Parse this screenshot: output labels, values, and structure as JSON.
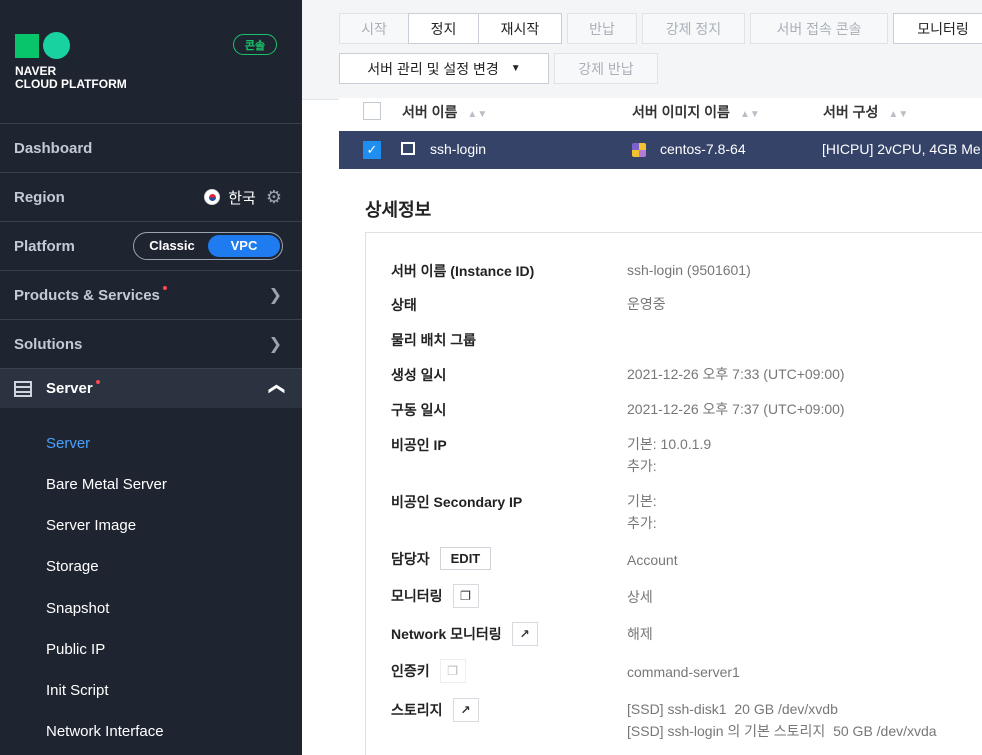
{
  "brand": {
    "line1": "NAVER",
    "line2": "CLOUD PLATFORM",
    "console_badge": "콘솔"
  },
  "sidebar": {
    "dashboard": "Dashboard",
    "region_label": "Region",
    "region_value": "한국",
    "platform_label": "Platform",
    "platform_options": [
      "Classic",
      "VPC"
    ],
    "platform_selected": "VPC",
    "products": "Products & Services",
    "solutions": "Solutions",
    "server": "Server",
    "submenu": [
      "Server",
      "Bare Metal Server",
      "Server Image",
      "Storage",
      "Snapshot",
      "Public IP",
      "Init Script",
      "Network Interface"
    ],
    "submenu_active": "Server"
  },
  "toolbar": {
    "row1": [
      "시작",
      "정지",
      "재시작",
      "반납",
      "강제 정지",
      "서버 접속 콘솔",
      "모니터링"
    ],
    "row1_enabled": [
      false,
      true,
      true,
      false,
      false,
      false,
      true
    ],
    "manage": "서버 관리 및 설정 변경",
    "force_return": "강제 반납"
  },
  "table": {
    "headers": [
      "서버 이름",
      "서버 이미지 이름",
      "서버 구성"
    ],
    "row": {
      "checked": true,
      "name": "ssh-login",
      "image": "centos-7.8-64",
      "spec": "[HICPU] 2vCPU, 4GB Me"
    }
  },
  "detail": {
    "title": "상세정보",
    "rows": [
      {
        "label": "서버 이름 (Instance ID)",
        "value": [
          "ssh-login (9501601)"
        ]
      },
      {
        "label": "상태",
        "value": [
          "운영중"
        ]
      },
      {
        "label": "물리 배치 그룹",
        "value": [
          ""
        ]
      },
      {
        "label": "생성 일시",
        "value": [
          "2021-12-26 오후 7:33 (UTC+09:00)"
        ]
      },
      {
        "label": "구동 일시",
        "value": [
          "2021-12-26 오후 7:37 (UTC+09:00)"
        ]
      },
      {
        "label": "비공인 IP",
        "value": [
          "기본: 10.0.1.9",
          "추가:"
        ]
      },
      {
        "label": "비공인 Secondary IP",
        "value": [
          "기본:",
          "추가:"
        ]
      },
      {
        "label": "담당자",
        "button": "EDIT",
        "value": [
          "Account"
        ]
      },
      {
        "label": "모니터링",
        "value": [
          "상세"
        ]
      },
      {
        "label": "Network 모니터링",
        "value": [
          "해제"
        ]
      },
      {
        "label": "인증키",
        "value": [
          "command-server1"
        ]
      },
      {
        "label": "스토리지",
        "value": [
          "[SSD] ssh-disk1  20 GB /dev/xvdb",
          "[SSD] ssh-login 의 기본 스토리지  50 GB /dev/xvda"
        ]
      }
    ]
  },
  "colors": {
    "sidebar_bg": "#1f2530",
    "accent": "#1e7bf0",
    "selected_row": "#354368",
    "brand_green": "#08c46a"
  }
}
